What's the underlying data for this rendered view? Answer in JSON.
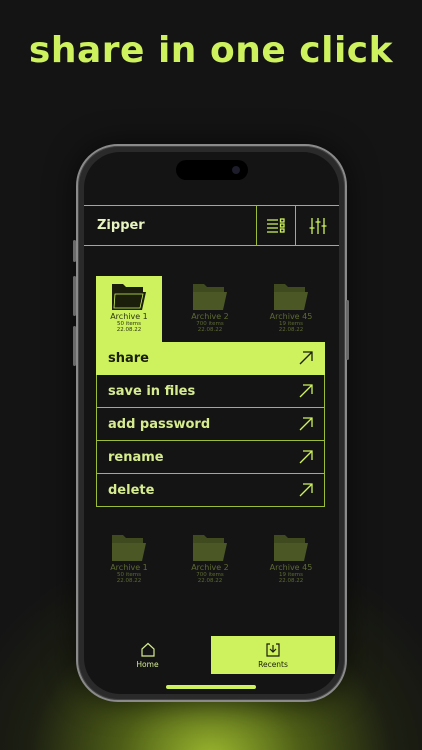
{
  "headline": "share in one click",
  "app": {
    "title": "Zipper"
  },
  "toolbar": {
    "list_icon": "list-view-icon",
    "filter_icon": "sliders-icon"
  },
  "folders_top": [
    {
      "name": "Archive 1",
      "items": "50 items",
      "date": "22.08.22",
      "selected": true
    },
    {
      "name": "Archive 2",
      "items": "700 items",
      "date": "22.08.22",
      "selected": false
    },
    {
      "name": "Archive 45",
      "items": "19 items",
      "date": "22.08.22",
      "selected": false
    }
  ],
  "menu": [
    {
      "label": "share",
      "active": true
    },
    {
      "label": "save in files",
      "active": false
    },
    {
      "label": "add password",
      "active": false
    },
    {
      "label": "rename",
      "active": false
    },
    {
      "label": "delete",
      "active": false
    }
  ],
  "folders_bottom": [
    {
      "name": "Archive 1",
      "items": "50 items",
      "date": "22.08.22"
    },
    {
      "name": "Archive 2",
      "items": "700 items",
      "date": "22.08.22"
    },
    {
      "name": "Archive 45",
      "items": "19 items",
      "date": "22.08.22"
    }
  ],
  "tabs": [
    {
      "label": "Home",
      "icon": "home-icon",
      "active": false
    },
    {
      "label": "Recents",
      "icon": "recents-icon",
      "active": true
    }
  ],
  "colors": {
    "accent": "#cdf25e",
    "background": "#141414",
    "folder_dim": "#3f4a1f"
  }
}
